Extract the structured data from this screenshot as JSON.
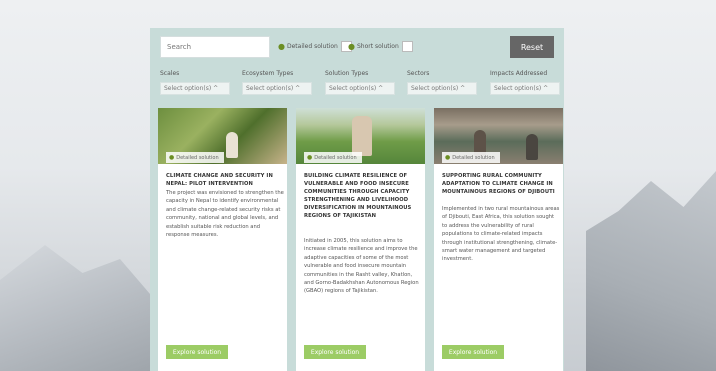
{
  "toolbar": {
    "search_placeholder": "Search",
    "detailed_label": "Detailed solution",
    "short_label": "Short solution",
    "reset_label": "Reset"
  },
  "filters": [
    {
      "label": "Scales",
      "placeholder": "Select option(s) ^"
    },
    {
      "label": "Ecosystem Types",
      "placeholder": "Select option(s) ^"
    },
    {
      "label": "Solution Types",
      "placeholder": "Select option(s) ^"
    },
    {
      "label": "Sectors",
      "placeholder": "Select option(s) ^"
    },
    {
      "label": "Impacts Addressed",
      "placeholder": "Select option(s) ^"
    }
  ],
  "cards": [
    {
      "badge": "Detailed solution",
      "title": "Climate change and security in Nepal: Pilot intervention",
      "description": "The project was envisioned to strengthen the capacity in Nepal to identify environmental and climate change-related security risks at community, national and global levels, and establish suitable risk reduction and response measures.",
      "button": "Explore solution"
    },
    {
      "badge": "Detailed solution",
      "title": "Building climate resilience of vulnerable and food insecure communities through capacity strengthening and livelihood diversification in mountainous regions of Tajikistan",
      "description": "Initiated in 2005, this solution aims to increase climate resilience and improve the adaptive capacities of some of the most vulnerable and food insecure mountain communities in the Rasht valley, Khatlon, and Gorno-Badakhshan Autonomous Region (GBAO) regions of Tajikistan.",
      "button": "Explore solution"
    },
    {
      "badge": "Detailed solution",
      "title": "Supporting rural community adaptation to climate change in mountainous regions of Djibouti",
      "description": "Implemented in two rural mountainous areas of Djibouti, East Africa, this solution sought to address the vulnerability of rural populations to climate-related impacts through institutional strengthening, climate-smart water management and targeted investment.",
      "button": "Explore solution"
    }
  ]
}
